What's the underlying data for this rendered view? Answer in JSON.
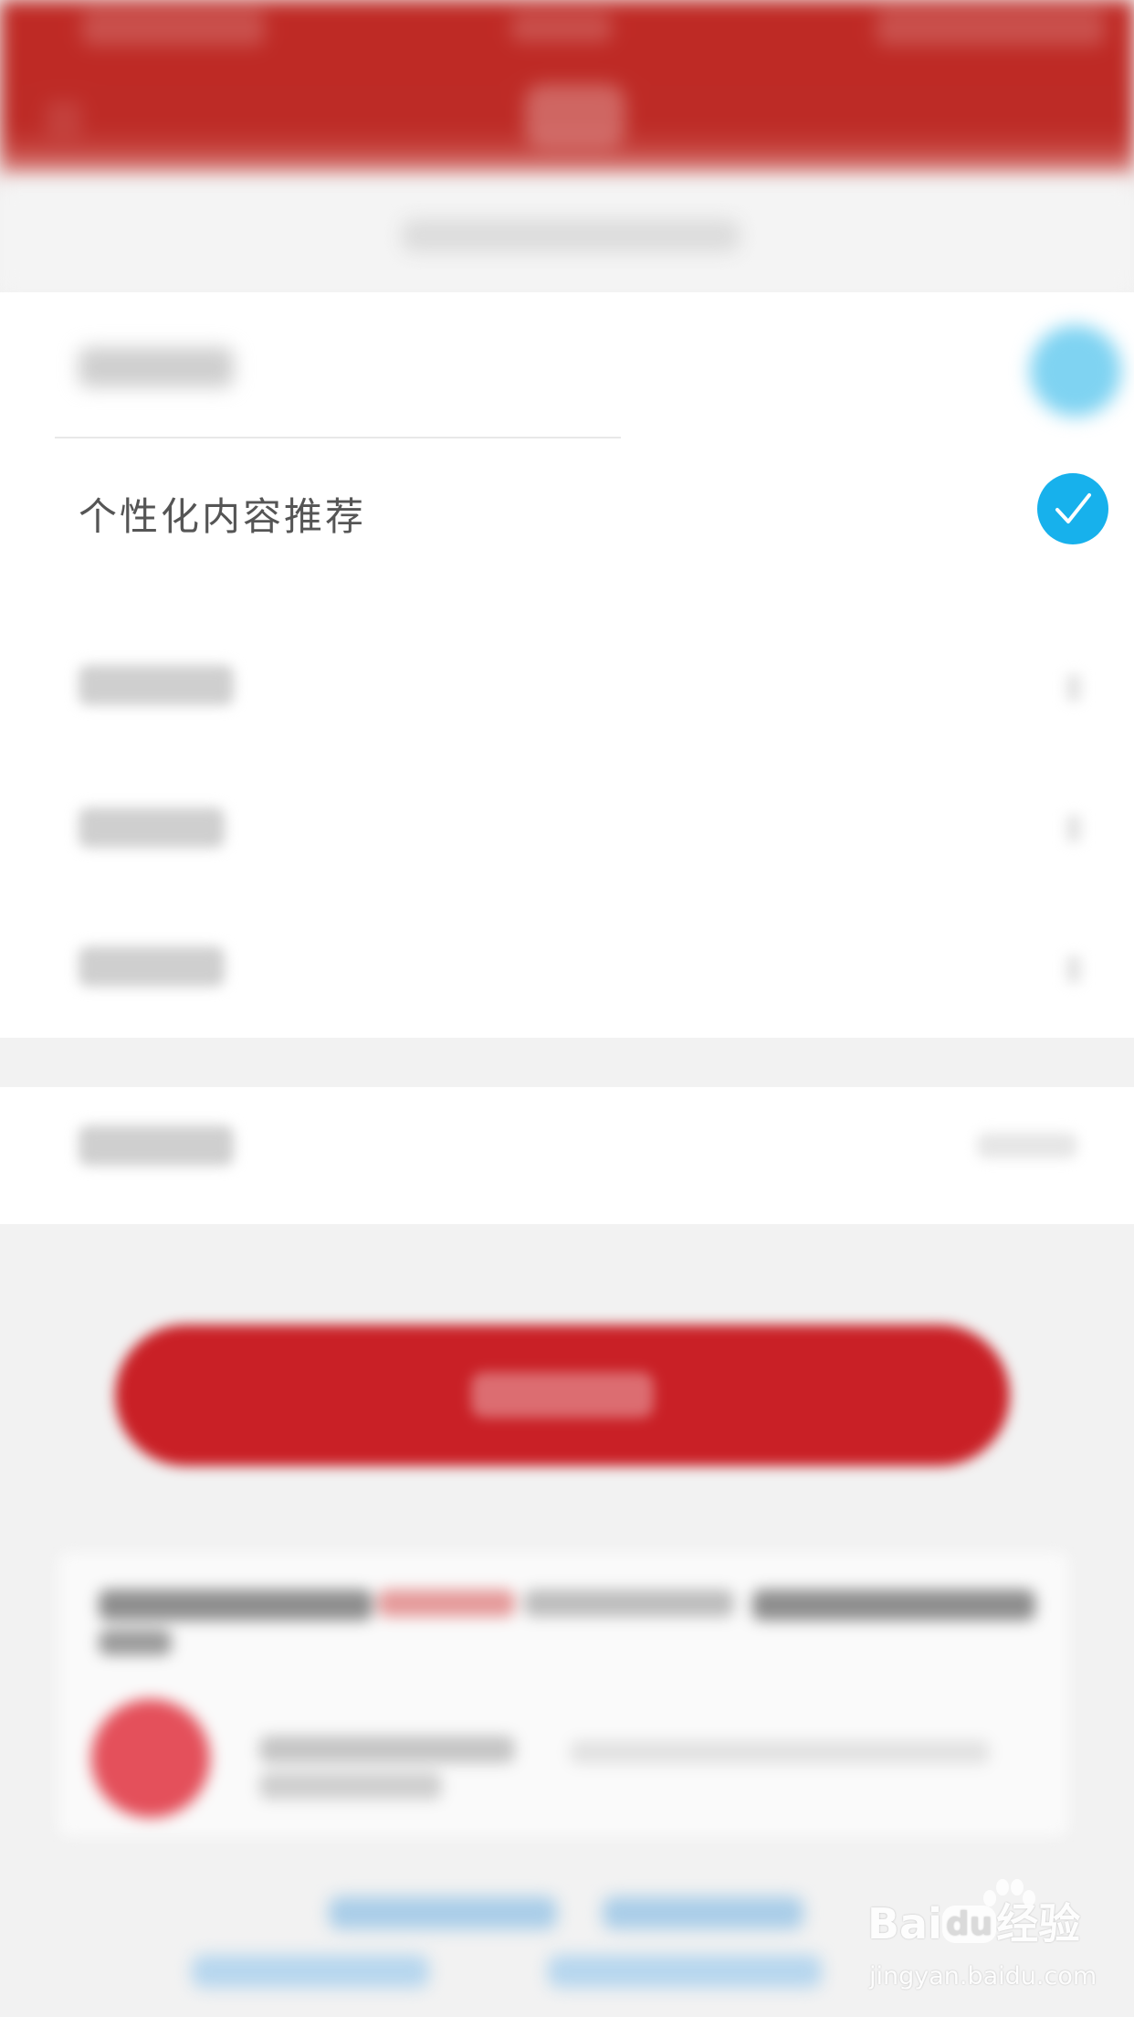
{
  "settings": {
    "personalized_recommendation": {
      "label": "个性化内容推荐",
      "checked": true,
      "check_color": "#17b1ec"
    }
  },
  "theme": {
    "header_color": "#bf2a25",
    "button_color": "#c92026"
  },
  "watermark": {
    "logo_text_left": "Bai",
    "logo_text_du": "du",
    "logo_text_right": "经验",
    "url": "jingyan.baidu.com"
  }
}
